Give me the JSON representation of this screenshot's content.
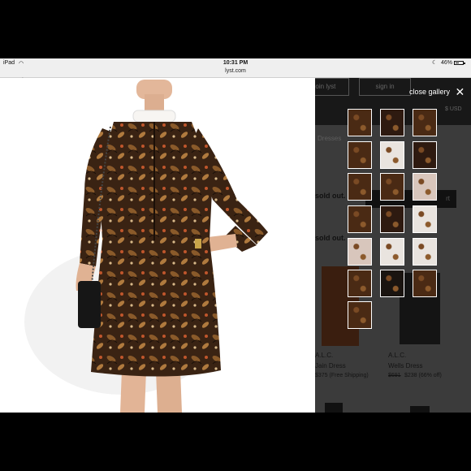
{
  "status_bar": {
    "carrier": "iPad",
    "time": "10:31 PM",
    "url": "lyst.com",
    "battery": "46%"
  },
  "header": {
    "search_label": "search",
    "join_label": "join lyst",
    "signin_label": "sign in",
    "currency": "$ USD"
  },
  "page": {
    "breadcrumb": "Dresses",
    "sold_out_1": "sold out.",
    "sold_out_2": "sold out.",
    "button_label": "rt"
  },
  "gallery": {
    "close_label": "close gallery",
    "thumb_count": 17
  },
  "products": [
    {
      "brand": "A.L.C.",
      "name": "Jain Dress",
      "price": "$375 (Free Shipping)"
    },
    {
      "brand": "A.L.C.",
      "name": "Wells Dress",
      "old_price": "$691",
      "price": "$238 (66% off)"
    }
  ]
}
